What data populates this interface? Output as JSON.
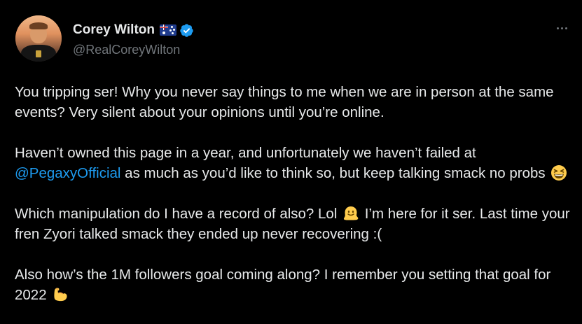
{
  "user": {
    "display_name": "Corey Wilton",
    "handle": "@RealCoreyWilton",
    "flag_icon": "australia-flag-icon",
    "verified_icon": "verified-badge-icon",
    "verified_color": "#1d9bf0"
  },
  "more_icon": "more-dots-icon",
  "tweet": {
    "p1": "You tripping ser! Why you never say things to me when we are in person at the same events? Very silent about your opinions until you’re online.",
    "p2_before": "Haven’t owned this page in a year, and unfortunately we haven’t failed at ",
    "p2_mention": "@PegaxyOfficial",
    "p2_after": " as much as you’d like to think so, but keep talking smack no probs",
    "p2_emoji": "grinning-squinting-face-emoji",
    "p3_before": "Which manipulation do I have a record of also? Lol",
    "p3_emoji": "melting-face-emoji",
    "p3_after": " I’m here for it ser. Last time your fren Zyori talked smack they ended up never recovering :(",
    "p4_before": "Also how’s the 1M followers goal coming along? I remember you setting that goal for 2022",
    "p4_emoji": "flexed-biceps-emoji"
  },
  "colors": {
    "background": "#000000",
    "text": "#e7e9ea",
    "secondary": "#71767b",
    "link": "#1d9bf0"
  }
}
